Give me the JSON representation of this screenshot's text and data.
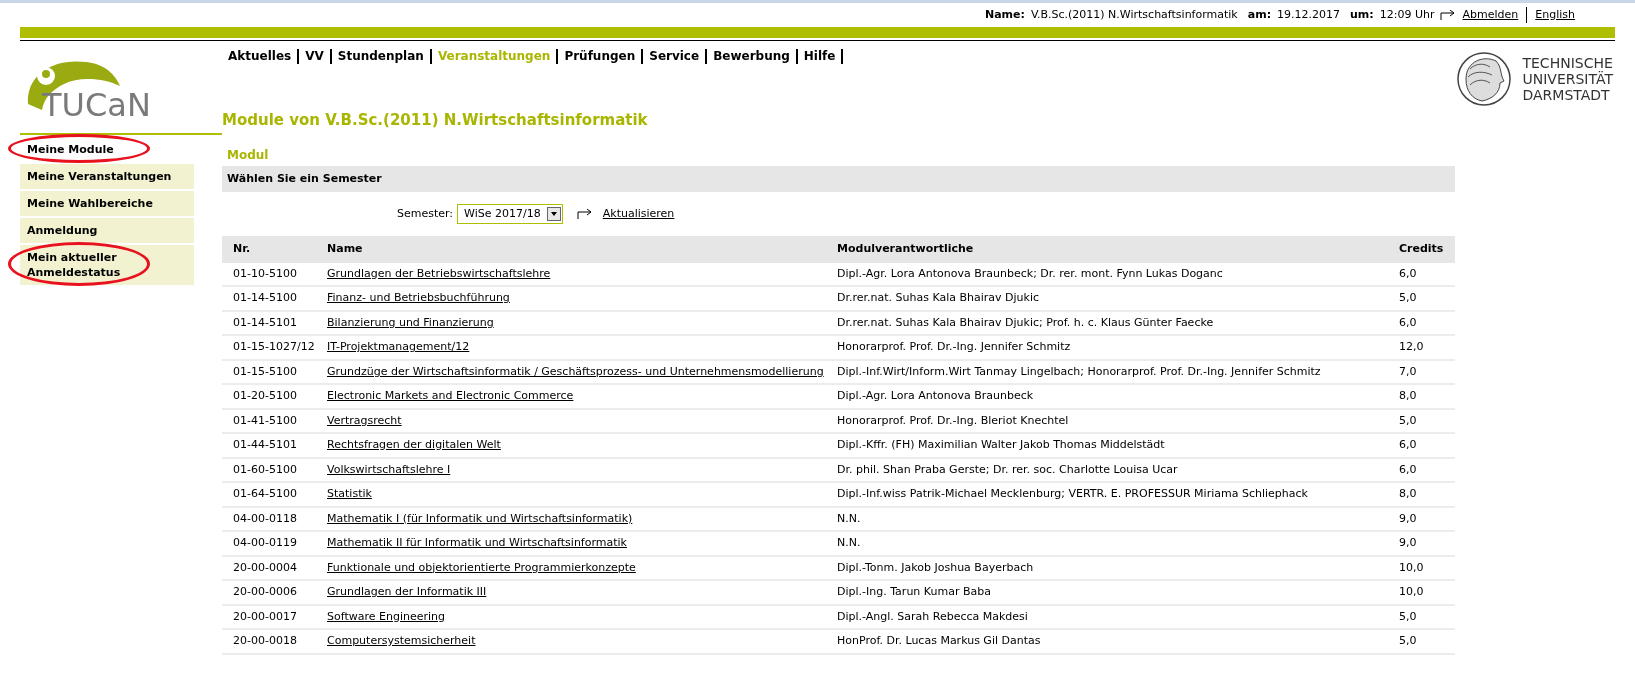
{
  "header": {
    "name_label": "Name:",
    "name_value": "V.B.Sc.(2011) N.Wirtschaftsinformatik",
    "date_label": "am:",
    "date_value": "19.12.2017",
    "time_label": "um:",
    "time_value": "12:09 Uhr",
    "logout": "Abmelden",
    "language": "English"
  },
  "logo": {
    "text": "TUCaN"
  },
  "university": {
    "lines": [
      "TECHNISCHE",
      "UNIVERSITÄT",
      "DARMSTADT"
    ]
  },
  "nav": [
    {
      "label": "Aktuelles",
      "selected": false
    },
    {
      "label": "VV",
      "selected": false
    },
    {
      "label": "Stundenplan",
      "selected": false
    },
    {
      "label": "Veranstaltungen",
      "selected": true
    },
    {
      "label": "Prüfungen",
      "selected": false
    },
    {
      "label": "Service",
      "selected": false
    },
    {
      "label": "Bewerbung",
      "selected": false
    },
    {
      "label": "Hilfe",
      "selected": false
    }
  ],
  "sidebar": {
    "items": [
      {
        "label": "Meine Module",
        "selected": true,
        "circled": true
      },
      {
        "label": "Meine Veranstaltungen",
        "selected": false,
        "circled": false
      },
      {
        "label": "Meine Wahlbereiche",
        "selected": false,
        "circled": false
      },
      {
        "label": "Anmeldung",
        "selected": false,
        "circled": false
      },
      {
        "label": "Mein aktueller Anmeldestatus",
        "selected": false,
        "circled": true
      }
    ]
  },
  "page_title": "Module von V.B.Sc.(2011) N.Wirtschaftsinformatik",
  "section_title": "Modul",
  "semester_bar": "Wählen Sie ein Semester",
  "semester": {
    "label": "Semester:",
    "value": "WiSe 2017/18",
    "button": "Aktualisieren"
  },
  "table": {
    "columns": [
      "Nr.",
      "Name",
      "Modulverantwortliche",
      "Credits"
    ],
    "rows": [
      [
        "01-10-5100",
        "Grundlagen der Betriebswirtschaftslehre",
        "Dipl.-Agr. Lora Antonova Braunbeck; Dr. rer. mont. Fynn Lukas Doganc",
        "6,0"
      ],
      [
        "01-14-5100",
        "Finanz- und Betriebsbuchführung",
        "Dr.rer.nat. Suhas Kala Bhairav Djukic",
        "5,0"
      ],
      [
        "01-14-5101",
        "Bilanzierung und Finanzierung",
        "Dr.rer.nat. Suhas Kala Bhairav Djukic; Prof. h. c. Klaus Günter Faecke",
        "6,0"
      ],
      [
        "01-15-1027/12",
        "IT-Projektmanagement/12",
        "Honorarprof. Prof. Dr.-Ing. Jennifer Schmitz",
        "12,0"
      ],
      [
        "01-15-5100",
        "Grundzüge der Wirtschaftsinformatik / Geschäftsprozess- und Unternehmensmodellierung",
        "Dipl.-Inf.Wirt/Inform.Wirt Tanmay Lingelbach; Honorarprof. Prof. Dr.-Ing. Jennifer Schmitz",
        "7,0"
      ],
      [
        "01-20-5100",
        "Electronic Markets and Electronic Commerce",
        "Dipl.-Agr. Lora Antonova Braunbeck",
        "8,0"
      ],
      [
        "01-41-5100",
        "Vertragsrecht",
        "Honorarprof. Prof. Dr.-Ing. Bleriot Knechtel",
        "5,0"
      ],
      [
        "01-44-5101",
        "Rechtsfragen der digitalen Welt",
        "Dipl.-Kffr. (FH) Maximilian Walter Jakob Thomas Middelstädt",
        "6,0"
      ],
      [
        "01-60-5100",
        "Volkswirtschaftslehre I",
        "Dr. phil. Shan Praba Gerste; Dr. rer. soc. Charlotte Louisa Ucar",
        "6,0"
      ],
      [
        "01-64-5100",
        "Statistik",
        "Dipl.-Inf.wiss Patrik-Michael Mecklenburg; VERTR. E. PROFESSUR Miriama Schliephack",
        "8,0"
      ],
      [
        "04-00-0118",
        "Mathematik I (für Informatik und Wirtschaftsinformatik)",
        "N.N.",
        "9,0"
      ],
      [
        "04-00-0119",
        "Mathematik II für Informatik und Wirtschaftsinformatik",
        "N.N.",
        "9,0"
      ],
      [
        "20-00-0004",
        "Funktionale und objektorientierte Programmierkonzepte",
        "Dipl.-Tonm. Jakob Joshua Bayerbach",
        "10,0"
      ],
      [
        "20-00-0006",
        "Grundlagen der Informatik III",
        "Dipl.-Ing. Tarun Kumar Baba",
        "10,0"
      ],
      [
        "20-00-0017",
        "Software Engineering",
        "Dipl.-Angl. Sarah Rebecca Makdesi",
        "5,0"
      ],
      [
        "20-00-0018",
        "Computersystemsicherheit",
        "HonProf. Dr. Lucas Markus Gil Dantas",
        "5,0"
      ]
    ]
  }
}
